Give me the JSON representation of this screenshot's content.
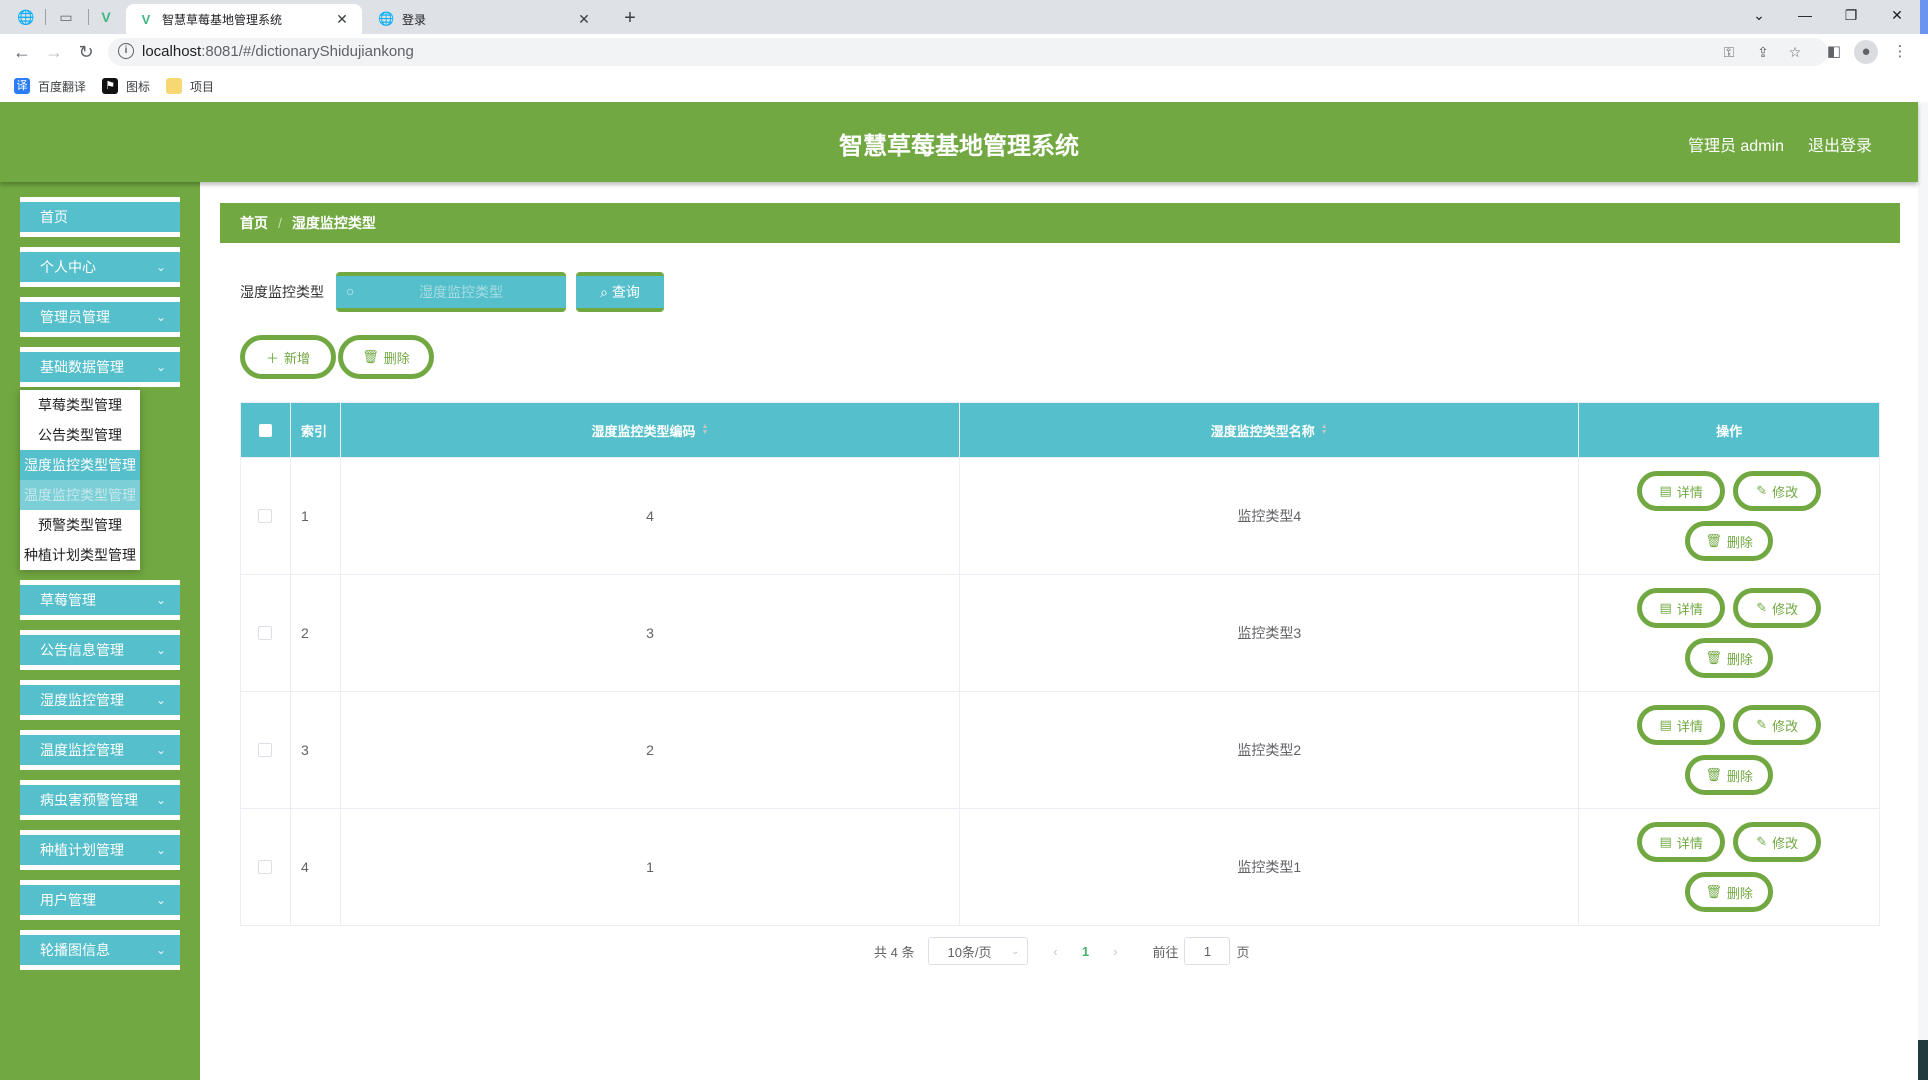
{
  "browser": {
    "tabs": [
      {
        "title": "智慧草莓基地管理系统",
        "active": true
      },
      {
        "title": "登录",
        "active": false
      }
    ],
    "url_host": "localhost",
    "url_path": ":8081/#/dictionaryShidujiankong",
    "bookmarks": [
      {
        "label": "百度翻译",
        "icon": "translate-icon"
      },
      {
        "label": "图标",
        "icon": "flag-icon"
      },
      {
        "label": "项目",
        "icon": "folder-icon"
      }
    ]
  },
  "header": {
    "title": "智慧草莓基地管理系统",
    "user": "管理员 admin",
    "logout": "退出登录"
  },
  "sidebar": {
    "items": [
      {
        "label": "首页",
        "expandable": false
      },
      {
        "label": "个人中心",
        "expandable": true
      },
      {
        "label": "管理员管理",
        "expandable": true
      },
      {
        "label": "基础数据管理",
        "expandable": true
      },
      {
        "label": "草莓管理",
        "expandable": true
      },
      {
        "label": "公告信息管理",
        "expandable": true
      },
      {
        "label": "湿度监控管理",
        "expandable": true
      },
      {
        "label": "温度监控管理",
        "expandable": true
      },
      {
        "label": "病虫害预警管理",
        "expandable": true
      },
      {
        "label": "种植计划管理",
        "expandable": true
      },
      {
        "label": "用户管理",
        "expandable": true
      },
      {
        "label": "轮播图信息",
        "expandable": true
      }
    ],
    "submenu": [
      {
        "label": "草莓类型管理",
        "state": "normal"
      },
      {
        "label": "公告类型管理",
        "state": "normal"
      },
      {
        "label": "湿度监控类型管理",
        "state": "active"
      },
      {
        "label": "温度监控类型管理",
        "state": "hover"
      },
      {
        "label": "预警类型管理",
        "state": "normal"
      },
      {
        "label": "种植计划类型管理",
        "state": "normal"
      }
    ]
  },
  "breadcrumb": {
    "home": "首页",
    "separator": "/",
    "current": "湿度监控类型"
  },
  "search": {
    "label": "湿度监控类型",
    "placeholder": "湿度监控类型",
    "value": "",
    "query_button": "查询"
  },
  "actions": {
    "add": "新增",
    "delete": "删除"
  },
  "table": {
    "columns": [
      "",
      "索引",
      "湿度监控类型编码",
      "湿度监控类型名称",
      "操作"
    ],
    "rows": [
      {
        "index": "1",
        "code": "4",
        "name": "监控类型4"
      },
      {
        "index": "2",
        "code": "3",
        "name": "监控类型3"
      },
      {
        "index": "3",
        "code": "2",
        "name": "监控类型2"
      },
      {
        "index": "4",
        "code": "1",
        "name": "监控类型1"
      }
    ],
    "row_actions": {
      "detail": "详情",
      "edit": "修改",
      "delete": "删除"
    }
  },
  "pagination": {
    "total": "共 4 条",
    "page_size": "10条/页",
    "current_page": "1",
    "goto_label": "前往",
    "goto_value": "1",
    "page_suffix": "页"
  },
  "colors": {
    "header_green": "#71a841",
    "menu_teal": "#55bfcb",
    "page_active": "#45b36b"
  }
}
